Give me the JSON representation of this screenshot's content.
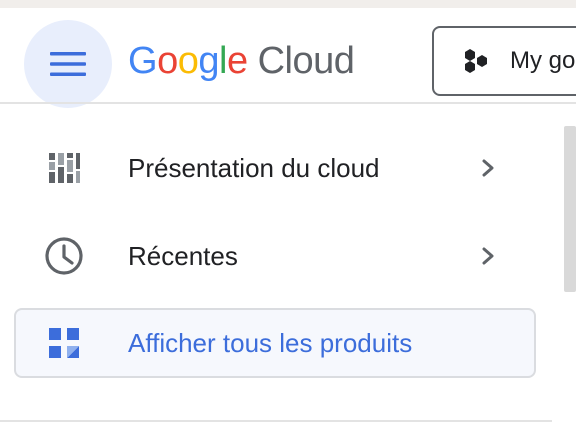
{
  "header": {
    "logo": {
      "letters": [
        {
          "char": "G",
          "color": "#4285f4"
        },
        {
          "char": "o",
          "color": "#ea4335"
        },
        {
          "char": "o",
          "color": "#fbbc05"
        },
        {
          "char": "g",
          "color": "#4285f4"
        },
        {
          "char": "l",
          "color": "#34a853"
        },
        {
          "char": "e",
          "color": "#ea4335"
        }
      ],
      "product": "Cloud"
    },
    "menu_icon": "hamburger-menu-icon",
    "project_selector": {
      "icon": "project-hexagons-icon",
      "label": "My go"
    }
  },
  "nav": {
    "items": [
      {
        "icon": "dashboard-overview-icon",
        "label": "Présentation du cloud",
        "has_chevron": true
      },
      {
        "icon": "clock-icon",
        "label": "Récentes",
        "has_chevron": true
      },
      {
        "icon": "grid-products-icon",
        "label": "Afficher tous les produits",
        "has_chevron": false,
        "selected": true
      }
    ]
  },
  "colors": {
    "accent": "#3c6ddb",
    "menu_button_bg": "#e8eefc",
    "selected_bg": "#f6f8fd",
    "icon_gray": "#5f6368"
  }
}
